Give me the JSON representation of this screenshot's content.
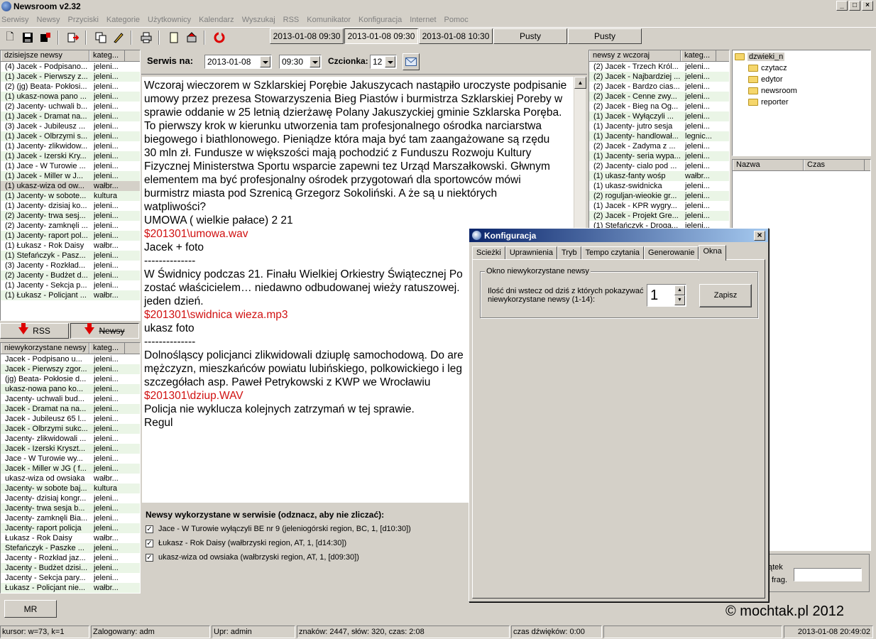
{
  "app": {
    "title": "Newsroom v2.32"
  },
  "menu": [
    "Serwisy",
    "Newsy",
    "Przyciski",
    "Kategorie",
    "Użytkownicy",
    "Kalendarz",
    "Wyszukaj",
    "RSS",
    "Komunikator",
    "Konfiguracja",
    "Internet",
    "Pomoc"
  ],
  "tabs": [
    "2013-01-08 09:30",
    "2013-01-08 09:30",
    "2013-01-08 10:30",
    "Pusty",
    "Pusty"
  ],
  "today_list": {
    "headers": [
      "dzisiejsze newsy",
      "kateg..."
    ],
    "rows": [
      [
        "(4) Jacek - Podpisano...",
        "jeleni..."
      ],
      [
        "(1) Jacek - Pierwszy z...",
        "jeleni..."
      ],
      [
        "(2) (jg) Beata- Pokłosi...",
        "jeleni..."
      ],
      [
        "(1) ukasz-nowa pano ...",
        "jeleni..."
      ],
      [
        "(2) Jacenty- uchwali b...",
        "jeleni..."
      ],
      [
        "(1) Jacek - Dramat na...",
        "jeleni..."
      ],
      [
        "(3) Jacek - Jubileusz ...",
        "jeleni..."
      ],
      [
        "(1) Jacek - Olbrzymi s...",
        "jeleni..."
      ],
      [
        "(1) Jacenty- zlikwidow...",
        "jeleni..."
      ],
      [
        "(1) Jacek - Izerski Kry...",
        "jeleni..."
      ],
      [
        "(1) Jace - W Turowie ...",
        "jeleni..."
      ],
      [
        "(1) Jacek - Miller w J...",
        "jeleni..."
      ],
      [
        "(1) ukasz-wiza od ow...",
        "wałbr..."
      ],
      [
        "(1) Jacenty- w sobote...",
        "kultura"
      ],
      [
        "(1) Jacenty- dzisiaj ko...",
        "jeleni..."
      ],
      [
        "(2) Jacenty- trwa sesj...",
        "jeleni..."
      ],
      [
        "(2) Jacenty- zamknęli ...",
        "jeleni..."
      ],
      [
        "(1) Jacenty- raport pol...",
        "jeleni..."
      ],
      [
        "(1) Łukasz - Rok Daisy",
        "wałbr..."
      ],
      [
        "(1) Stefańczyk - Pasz...",
        "jeleni..."
      ],
      [
        "(3) Jacenty - Rozkład...",
        "jeleni..."
      ],
      [
        "(2) Jacenty - Budżet d...",
        "jeleni..."
      ],
      [
        "(1) Jacenty - Sekcja p...",
        "jeleni..."
      ],
      [
        "(1) Łukasz - Policjant ...",
        "wałbr..."
      ]
    ]
  },
  "buttons": {
    "rss": "RSS",
    "newsy": "Newsy",
    "mr": "MR"
  },
  "unused_list": {
    "headers": [
      "niewykorzystane newsy",
      "kateg..."
    ],
    "rows": [
      [
        "Jacek - Podpisano u...",
        "jeleni..."
      ],
      [
        "Jacek - Pierwszy zgor...",
        "jeleni..."
      ],
      [
        "(jg) Beata- Pokłosie d...",
        "jeleni..."
      ],
      [
        "ukasz-nowa pano ko...",
        "jeleni..."
      ],
      [
        "Jacenty- uchwali bud...",
        "jeleni..."
      ],
      [
        "Jacek - Dramat na na...",
        "jeleni..."
      ],
      [
        "Jacek - Jubileusz 65 l...",
        "jeleni..."
      ],
      [
        "Jacek - Olbrzymi sukc...",
        "jeleni..."
      ],
      [
        "Jacenty- zlikwidowali ...",
        "jeleni..."
      ],
      [
        "Jacek - Izerski Kryszt...",
        "jeleni..."
      ],
      [
        "Jace - W Turowie wy...",
        "jeleni..."
      ],
      [
        "Jacek - Miller w JG ( f...",
        "jeleni..."
      ],
      [
        "ukasz-wiza od owsiaka",
        "wałbr..."
      ],
      [
        "Jacenty- w sobote baj...",
        "kultura"
      ],
      [
        "Jacenty- dzisiaj kongr...",
        "jeleni..."
      ],
      [
        "Jacenty- trwa sesja b...",
        "jeleni..."
      ],
      [
        "Jacenty- zamknęli Bia...",
        "jeleni..."
      ],
      [
        "Jacenty- raport policja",
        "jeleni..."
      ],
      [
        "Łukasz - Rok Daisy",
        "wałbr..."
      ],
      [
        "Stefańczyk - Paszke ...",
        "jeleni..."
      ],
      [
        "Jacenty - Rozkład jaz...",
        "jeleni..."
      ],
      [
        "Jacenty - Budżet dzisi...",
        "jeleni..."
      ],
      [
        "Jacenty - Sekcja pary...",
        "jeleni..."
      ],
      [
        "Łukasz - Policjant nie...",
        "wałbr..."
      ]
    ]
  },
  "serwis": {
    "label": "Serwis na:",
    "date": "2013-01-08",
    "time": "09:30",
    "font_label": "Czcionka:",
    "font_size": "12"
  },
  "editor": {
    "lines": [
      {
        "t": "Wczoraj wieczorem w Szklarskiej Porębie Jakuszycach nastąpiło uroczyste podpisanie",
        "c": "n"
      },
      {
        "t": "umowy przez prezesa Stowarzyszenia Bieg Piastów i burmistrza Szklarskiej Poreby w",
        "c": "n"
      },
      {
        "t": "sprawie oddanie w 25 letnią dzierżawę Polany Jakuszyckiej gminie Szklarska Poręba.",
        "c": "n"
      },
      {
        "t": "To pierwszy krok w kierunku utworzenia tam profesjonalnego ośrodka narciarstwa",
        "c": "n"
      },
      {
        "t": "biegowego i biathlonowego. Pieniądze która maja być tam zaangażowane są rzędu",
        "c": "n"
      },
      {
        "t": "30 mln zł. Fundusze w większości mają pochodzić z Funduszu Rozwoju Kultury",
        "c": "n"
      },
      {
        "t": "Fizycznej Ministerstwa Sportu wsparcie zapewni tez Urząd Marszałkowski. Głwnym",
        "c": "n"
      },
      {
        "t": "elementem ma być profesjonalny ośrodek przygotowań dla sportowców mówi",
        "c": "n"
      },
      {
        "t": "burmistrz miasta pod Szrenicą Grzegorz Sokoliński. A że są u niektórych",
        "c": "n"
      },
      {
        "t": "watpliwości?",
        "c": "n"
      },
      {
        "t": "UMOWA ( wielkie pałace) 2 21",
        "c": "n"
      },
      {
        "t": "$201301\\umowa.wav",
        "c": "r"
      },
      {
        "t": "Jacek + foto",
        "c": "n"
      },
      {
        "t": " ",
        "c": "n"
      },
      {
        "t": " ",
        "c": "n"
      },
      {
        "t": "--------------",
        "c": "n"
      },
      {
        "t": " ",
        "c": "n"
      },
      {
        "t": "W Świdnicy podczas 21. Finału Wielkiej Orkiestry Świątecznej Po",
        "c": "n"
      },
      {
        "t": "zostać właścicielem… niedawno odbudowanej wieży ratuszowej.",
        "c": "n"
      },
      {
        "t": "jeden dzień.",
        "c": "n"
      },
      {
        "t": "$201301\\swidnica wieza.mp3",
        "c": "r"
      },
      {
        "t": "ukasz foto",
        "c": "n"
      },
      {
        "t": " ",
        "c": "n"
      },
      {
        "t": "--------------",
        "c": "n"
      },
      {
        "t": " ",
        "c": "n"
      },
      {
        "t": "Dolnośląscy policjanci zlikwidowali dziuplę samochodową. Do are",
        "c": "n"
      },
      {
        "t": "mężczyzn, mieszkańców powiatu lubińskiego, polkowickiego i leg",
        "c": "n"
      },
      {
        "t": "szczegółach asp. Paweł Petrykowski z KWP we Wrocławiu",
        "c": "n"
      },
      {
        "t": "$201301\\dziup.WAV",
        "c": "r"
      },
      {
        "t": "Policja nie wyklucza kolejnych zatrzymań w tej sprawie.",
        "c": "n"
      },
      {
        "t": " ",
        "c": "n"
      },
      {
        "t": "Regul",
        "c": "n"
      }
    ]
  },
  "used": {
    "title": "Newsy wykorzystane w serwisie (odznacz, aby nie zliczać):",
    "items": [
      "Jace - W Turowie wyłączyli BE nr 9 (jeleniogórski region, BC, 1, [d10:30])",
      "Łukasz - Rok Daisy (wałbrzyski region, AT, 1, [d14:30])",
      "ukasz-wiza od owsiaka (wałbrzyski region, AT, 1, [d09:30])"
    ]
  },
  "yesterday_list": {
    "headers": [
      "newsy z wczoraj",
      "kateg..."
    ],
    "rows": [
      [
        "(2) Jacek - Trzech Król...",
        "jeleni..."
      ],
      [
        "(2) Jacek - Najbardziej ...",
        "jeleni..."
      ],
      [
        "(2) Jacek - Bardzo cias...",
        "jeleni..."
      ],
      [
        "(2) Jacek - Cenne zwy...",
        "jeleni..."
      ],
      [
        "(2) Jacek - Bieg na Og...",
        "jeleni..."
      ],
      [
        "(1) Jacek - Wyłączyli ...",
        "jeleni..."
      ],
      [
        "(1) Jacenty- jutro sesja",
        "jeleni..."
      ],
      [
        "(1) Jacenty- handlował...",
        "legnic..."
      ],
      [
        "(2) Jacek - Zadyma z ...",
        "jeleni..."
      ],
      [
        "(1) Jacenty- seria wypa...",
        "jeleni..."
      ],
      [
        "(2) Jacenty- cialo pod ...",
        "jeleni..."
      ],
      [
        "(1) ukasz-fanty wośp",
        "wałbr..."
      ],
      [
        "(1) ukasz-swidnicka",
        "jeleni..."
      ],
      [
        "(2) roguljan-wieokie gr...",
        "jeleni..."
      ],
      [
        "(1) Jacek - KPR wygry...",
        "jeleni..."
      ],
      [
        "(2) Jacek - Projekt Gre...",
        "jeleni..."
      ],
      [
        "(1) Stefańczyk - Droga...",
        "jeleni..."
      ]
    ]
  },
  "tree": {
    "root": "dzwieki_n",
    "children": [
      "czytacz",
      "edytor",
      "newsroom",
      "reporter"
    ]
  },
  "right_list": {
    "headers": [
      "Nazwa",
      "Czas"
    ]
  },
  "right_bottom": {
    "label1": "ątek",
    "label2": "frag."
  },
  "dialog": {
    "title": "Konfiguracja",
    "tabs": [
      "Scieżki",
      "Uprawnienia",
      "Tryb",
      "Tempo czytania",
      "Generowanie",
      "Okna"
    ],
    "group_label": "Okno niewykorzystane newsy",
    "field_label_1": "Ilość dni wstecz od dziś z których pokazywać",
    "field_label_2": "niewykorzystane newsy (1-14):",
    "value": "1",
    "save": "Zapisz"
  },
  "watermark": "© mochtak.pl 2012",
  "status": [
    "kursor: w=73, k=1",
    "Zalogowany: adm",
    "Upr: admin",
    "znaków: 2447, słów: 320, czas: 2:08",
    "czas dźwięków: 0:00",
    "",
    "2013-01-08 20:49:02"
  ]
}
